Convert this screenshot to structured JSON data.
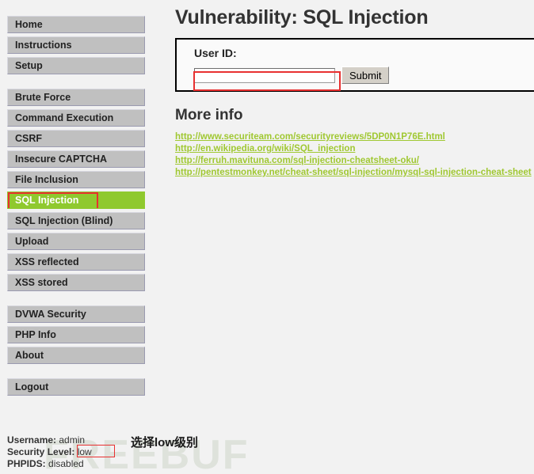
{
  "sidebar": {
    "groups": [
      {
        "name": "primary",
        "items": [
          {
            "label": "Home",
            "selected": false
          },
          {
            "label": "Instructions",
            "selected": false
          },
          {
            "label": "Setup",
            "selected": false
          }
        ]
      },
      {
        "name": "vulnerabilities",
        "items": [
          {
            "label": "Brute Force",
            "selected": false
          },
          {
            "label": "Command Execution",
            "selected": false
          },
          {
            "label": "CSRF",
            "selected": false
          },
          {
            "label": "Insecure CAPTCHA",
            "selected": false
          },
          {
            "label": "File Inclusion",
            "selected": false
          },
          {
            "label": "SQL Injection",
            "selected": true
          },
          {
            "label": "SQL Injection (Blind)",
            "selected": false
          },
          {
            "label": "Upload",
            "selected": false
          },
          {
            "label": "XSS reflected",
            "selected": false
          },
          {
            "label": "XSS stored",
            "selected": false
          }
        ]
      },
      {
        "name": "meta",
        "items": [
          {
            "label": "DVWA Security",
            "selected": false
          },
          {
            "label": "PHP Info",
            "selected": false
          },
          {
            "label": "About",
            "selected": false
          }
        ]
      },
      {
        "name": "session",
        "items": [
          {
            "label": "Logout",
            "selected": false
          }
        ]
      }
    ]
  },
  "main": {
    "page_title": "Vulnerability: SQL Injection",
    "form": {
      "label": "User ID:",
      "input_value": "",
      "input_placeholder": "",
      "submit_label": "Submit"
    },
    "more_info": {
      "heading": "More info",
      "links": [
        "http://www.securiteam.com/securityreviews/5DP0N1P76E.html",
        "http://en.wikipedia.org/wiki/SQL_injection",
        "http://ferruh.mavituna.com/sql-injection-cheatsheet-oku/",
        "http://pentestmonkey.net/cheat-sheet/sql-injection/mysql-sql-injection-cheat-sheet"
      ]
    }
  },
  "status": {
    "username_key": "Username:",
    "username_value": "admin",
    "security_key": "Security Level:",
    "security_value": "low",
    "phpids_key": "PHPIDS:",
    "phpids_value": "disabled"
  },
  "annotation": {
    "note": "选择low级别"
  },
  "watermark": {
    "text": "FREEBUF"
  },
  "colors": {
    "selected_green": "#8fc92e",
    "link_green": "#a0c832",
    "annotation_red": "#e83030",
    "button_gray": "#c0c0c0",
    "page_background": "#f2f2f2"
  }
}
